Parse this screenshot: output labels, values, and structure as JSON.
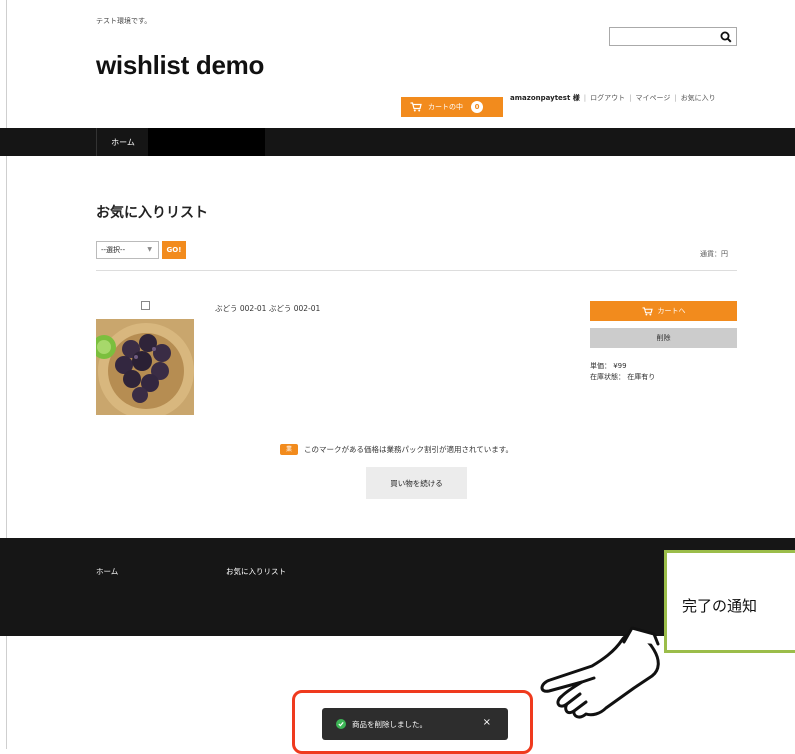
{
  "header": {
    "env_note": "テスト環境です。",
    "site_title": "wishlist demo",
    "search": {
      "placeholder": "",
      "value": ""
    },
    "cart": {
      "label": "カートの中",
      "count": "0"
    },
    "user": {
      "name": "amazonpaytest 様",
      "links": [
        "ログアウト",
        "マイページ",
        "お気に入り"
      ]
    }
  },
  "nav": {
    "items": [
      "ホーム"
    ]
  },
  "main": {
    "heading": "お気に入りリスト",
    "select": {
      "value": "--選択--",
      "go_label": "GO!"
    },
    "currency": "通貨：円",
    "items": [
      {
        "name": "ぶどう 002-01 ぶどう 002-01",
        "add_cart_label": "カートへ",
        "delete_label": "削除",
        "price": "単価： ¥99",
        "stock": "在庫状態： 在庫有り"
      }
    ],
    "pack_mark": "業",
    "pack_note": "このマークがある価格は業務パック割引が適用されています。",
    "continue_label": "買い物を続ける"
  },
  "footer": {
    "links": [
      "ホーム",
      "お気に入りリスト"
    ]
  },
  "callout": {
    "text": "完了の通知"
  },
  "toast": {
    "message": "商品を削除しました。",
    "close": "×"
  },
  "colors": {
    "accent": "#f28b1d",
    "callout_border": "#9bbd4a",
    "highlight": "#ef3a1e",
    "toast_bg": "#2d2d2d"
  }
}
